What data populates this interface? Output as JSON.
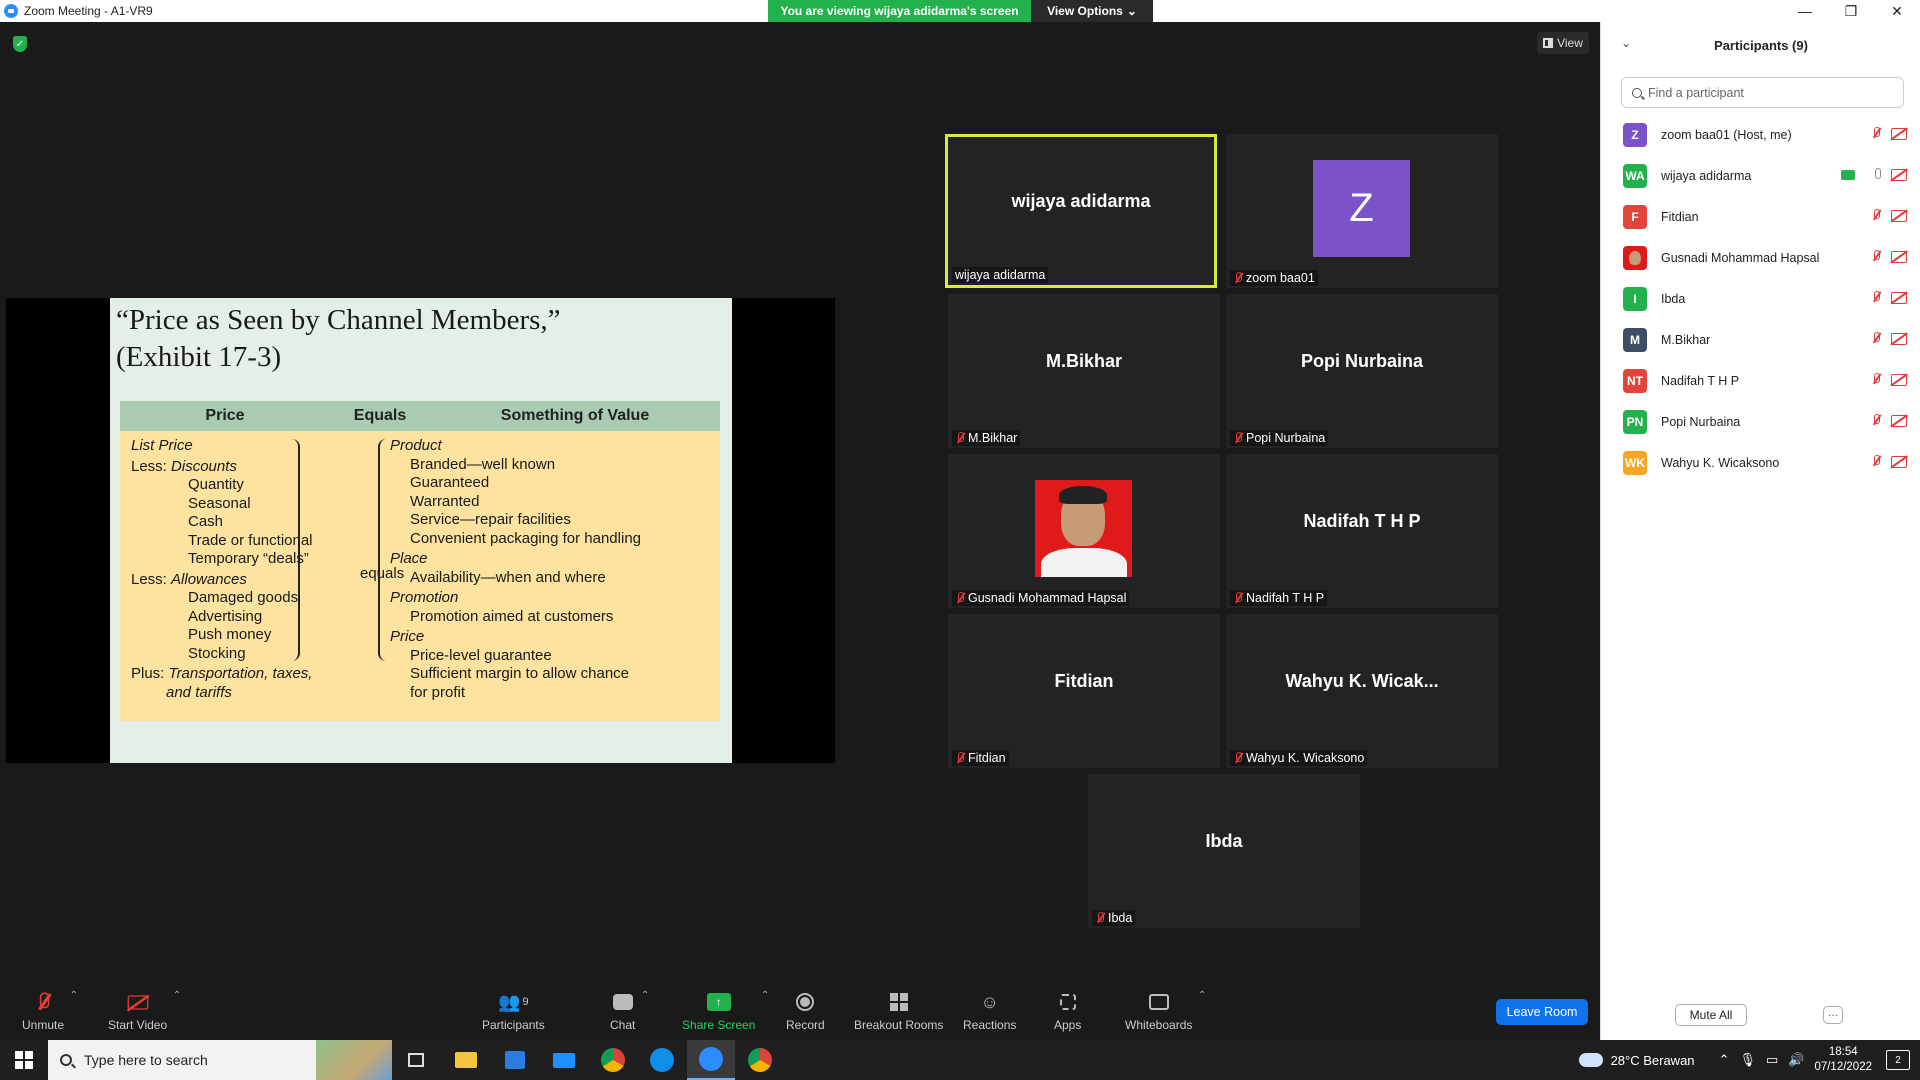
{
  "window": {
    "title": "Zoom Meeting - A1-VR9",
    "controls": [
      "—",
      "❐",
      "✕"
    ]
  },
  "banner": {
    "viewing": "You are viewing wijaya adidarma's screen",
    "view_options": "View Options",
    "view_options_caret": "⌄"
  },
  "view_button": "View",
  "slide": {
    "title_line1": "“Price as Seen by Channel Members,”",
    "title_line2": "(Exhibit 17-3)",
    "headers": [
      "Price",
      "Equals",
      "Something of Value"
    ],
    "equals_word": "equals",
    "price_col": [
      {
        "text": "List Price",
        "style": "it"
      },
      {
        "prefix": "Less: ",
        "text": "Discounts",
        "style": "it-prefix"
      },
      {
        "text": "Quantity",
        "style": "ind"
      },
      {
        "text": "Seasonal",
        "style": "ind"
      },
      {
        "text": "Cash",
        "style": "ind"
      },
      {
        "text": "Trade or functional",
        "style": "ind"
      },
      {
        "text": "Temporary “deals”",
        "style": "ind"
      },
      {
        "prefix": "Less: ",
        "text": "Allowances",
        "style": "it-prefix"
      },
      {
        "text": "Damaged goods",
        "style": "ind"
      },
      {
        "text": "Advertising",
        "style": "ind"
      },
      {
        "text": "Push money",
        "style": "ind"
      },
      {
        "text": "Stocking",
        "style": "ind"
      },
      {
        "prefix": "Plus: ",
        "text": "Transportation, taxes,",
        "style": "it-prefix"
      },
      {
        "text": "and tariffs",
        "style": "it-hang"
      }
    ],
    "value_col": [
      {
        "text": "Product",
        "style": "it"
      },
      {
        "text": "Branded—well known",
        "style": "ind2"
      },
      {
        "text": "Guaranteed",
        "style": "ind2"
      },
      {
        "text": "Warranted",
        "style": "ind2"
      },
      {
        "text": "Service—repair facilities",
        "style": "ind2"
      },
      {
        "text": "Convenient packaging for handling",
        "style": "ind2"
      },
      {
        "text": "Place",
        "style": "it"
      },
      {
        "text": "Availability—when and where",
        "style": "ind2"
      },
      {
        "text": "Promotion",
        "style": "it"
      },
      {
        "text": "Promotion aimed at customers",
        "style": "ind2"
      },
      {
        "text": "Price",
        "style": "it"
      },
      {
        "text": "Price-level guarantee",
        "style": "ind2"
      },
      {
        "text": "Sufficient margin to allow chance",
        "style": "ind2"
      },
      {
        "text": "for profit",
        "style": "ind2"
      }
    ]
  },
  "tiles": [
    {
      "big": "wijaya adidarma",
      "label": "wijaya adidarma",
      "muted": false,
      "active": true,
      "kind": "name"
    },
    {
      "big": "Z",
      "label": "zoom baa01",
      "muted": true,
      "active": false,
      "kind": "avatar",
      "avatar_color": "#7b52c7"
    },
    {
      "big": "M.Bikhar",
      "label": "M.Bikhar",
      "muted": true,
      "active": false,
      "kind": "name"
    },
    {
      "big": "Popi Nurbaina",
      "label": "Popi Nurbaina",
      "muted": true,
      "active": false,
      "kind": "name"
    },
    {
      "big": "",
      "label": "Gusnadi Mohammad Hapsal",
      "muted": true,
      "active": false,
      "kind": "photo"
    },
    {
      "big": "Nadifah T H P",
      "label": "Nadifah T H P",
      "muted": true,
      "active": false,
      "kind": "name"
    },
    {
      "big": "Fitdian",
      "label": "Fitdian",
      "muted": true,
      "active": false,
      "kind": "name"
    },
    {
      "big": "Wahyu K. Wicak...",
      "label": "Wahyu K. Wicaksono",
      "muted": true,
      "active": false,
      "kind": "name"
    },
    {
      "big": "Ibda",
      "label": "Ibda",
      "muted": true,
      "active": false,
      "kind": "name"
    }
  ],
  "toolbar": {
    "unmute": "Unmute",
    "start_video": "Start Video",
    "participants": "Participants",
    "participants_count": "9",
    "chat": "Chat",
    "share_screen": "Share Screen",
    "record": "Record",
    "breakout_rooms": "Breakout Rooms",
    "reactions": "Reactions",
    "apps": "Apps",
    "whiteboards": "Whiteboards",
    "leave_room": "Leave Room",
    "caret": "⌃"
  },
  "panel": {
    "title": "Participants (9)",
    "search_placeholder": "Find a participant",
    "participants": [
      {
        "initials": "Z",
        "name": "zoom baa01 (Host, me)",
        "color": "#7b52c7",
        "mic": "off",
        "sharing": false
      },
      {
        "initials": "WA",
        "name": "wijaya adidarma",
        "color": "#23b14d",
        "mic": "on",
        "sharing": true
      },
      {
        "initials": "F",
        "name": "Fitdian",
        "color": "#e0443a",
        "mic": "off",
        "sharing": false
      },
      {
        "initials": "",
        "name": "Gusnadi Mohammad Hapsal",
        "color": "#e01a1a",
        "mic": "off",
        "sharing": false
      },
      {
        "initials": "I",
        "name": "Ibda",
        "color": "#23b14d",
        "mic": "off",
        "sharing": false
      },
      {
        "initials": "M",
        "name": "M.Bikhar",
        "color": "#3d4f66",
        "mic": "off",
        "sharing": false
      },
      {
        "initials": "NT",
        "name": "Nadifah T H P",
        "color": "#e0443a",
        "mic": "off",
        "sharing": false
      },
      {
        "initials": "PN",
        "name": "Popi Nurbaina",
        "color": "#23b14d",
        "mic": "off",
        "sharing": false
      },
      {
        "initials": "WK",
        "name": "Wahyu K. Wicaksono",
        "color": "#f5a623",
        "mic": "off",
        "sharing": false
      }
    ],
    "mute_all": "Mute All",
    "more": "···"
  },
  "taskbar": {
    "search_placeholder": "Type here to search",
    "weather": "28°C  Berawan",
    "time": "18:54",
    "date": "07/12/2022",
    "notifications": "2"
  }
}
